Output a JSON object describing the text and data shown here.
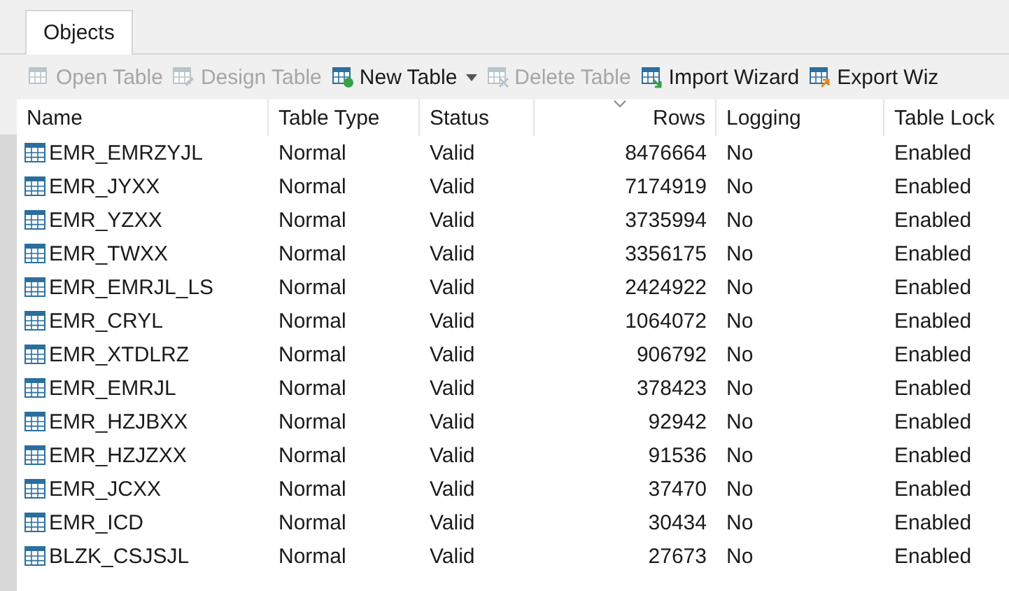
{
  "tabs": [
    {
      "label": "Objects",
      "selected": true
    }
  ],
  "toolbar": [
    {
      "label": "Open Table",
      "disabled": true,
      "kind": "open",
      "dropdown": false
    },
    {
      "label": "Design Table",
      "disabled": true,
      "kind": "design",
      "dropdown": false
    },
    {
      "label": "New Table",
      "disabled": false,
      "kind": "new",
      "dropdown": true
    },
    {
      "label": "Delete Table",
      "disabled": true,
      "kind": "delete",
      "dropdown": false
    },
    {
      "label": "Import Wizard",
      "disabled": false,
      "kind": "import",
      "dropdown": false
    },
    {
      "label": "Export Wiz",
      "disabled": false,
      "kind": "export",
      "dropdown": false
    }
  ],
  "table": {
    "columns": [
      {
        "label": "Name",
        "kind": "text",
        "sorted": false
      },
      {
        "label": "Table Type",
        "kind": "text",
        "sorted": false
      },
      {
        "label": "Status",
        "kind": "text",
        "sorted": false
      },
      {
        "label": "Rows",
        "kind": "number",
        "sorted": true
      },
      {
        "label": "Logging",
        "kind": "text",
        "sorted": false
      },
      {
        "label": "Table Lock",
        "kind": "text",
        "sorted": false
      }
    ],
    "rows": [
      [
        "EMR_EMRZYJL",
        "Normal",
        "Valid",
        "8476664",
        "No",
        "Enabled"
      ],
      [
        "EMR_JYXX",
        "Normal",
        "Valid",
        "7174919",
        "No",
        "Enabled"
      ],
      [
        "EMR_YZXX",
        "Normal",
        "Valid",
        "3735994",
        "No",
        "Enabled"
      ],
      [
        "EMR_TWXX",
        "Normal",
        "Valid",
        "3356175",
        "No",
        "Enabled"
      ],
      [
        "EMR_EMRJL_LS",
        "Normal",
        "Valid",
        "2424922",
        "No",
        "Enabled"
      ],
      [
        "EMR_CRYL",
        "Normal",
        "Valid",
        "1064072",
        "No",
        "Enabled"
      ],
      [
        "EMR_XTDLRZ",
        "Normal",
        "Valid",
        "906792",
        "No",
        "Enabled"
      ],
      [
        "EMR_EMRJL",
        "Normal",
        "Valid",
        "378423",
        "No",
        "Enabled"
      ],
      [
        "EMR_HZJBXX",
        "Normal",
        "Valid",
        "92942",
        "No",
        "Enabled"
      ],
      [
        "EMR_HZJZXX",
        "Normal",
        "Valid",
        "91536",
        "No",
        "Enabled"
      ],
      [
        "EMR_JCXX",
        "Normal",
        "Valid",
        "37470",
        "No",
        "Enabled"
      ],
      [
        "EMR_ICD",
        "Normal",
        "Valid",
        "30434",
        "No",
        "Enabled"
      ],
      [
        "BLZK_CSJSJL",
        "Normal",
        "Valid",
        "27673",
        "No",
        "Enabled"
      ]
    ]
  }
}
